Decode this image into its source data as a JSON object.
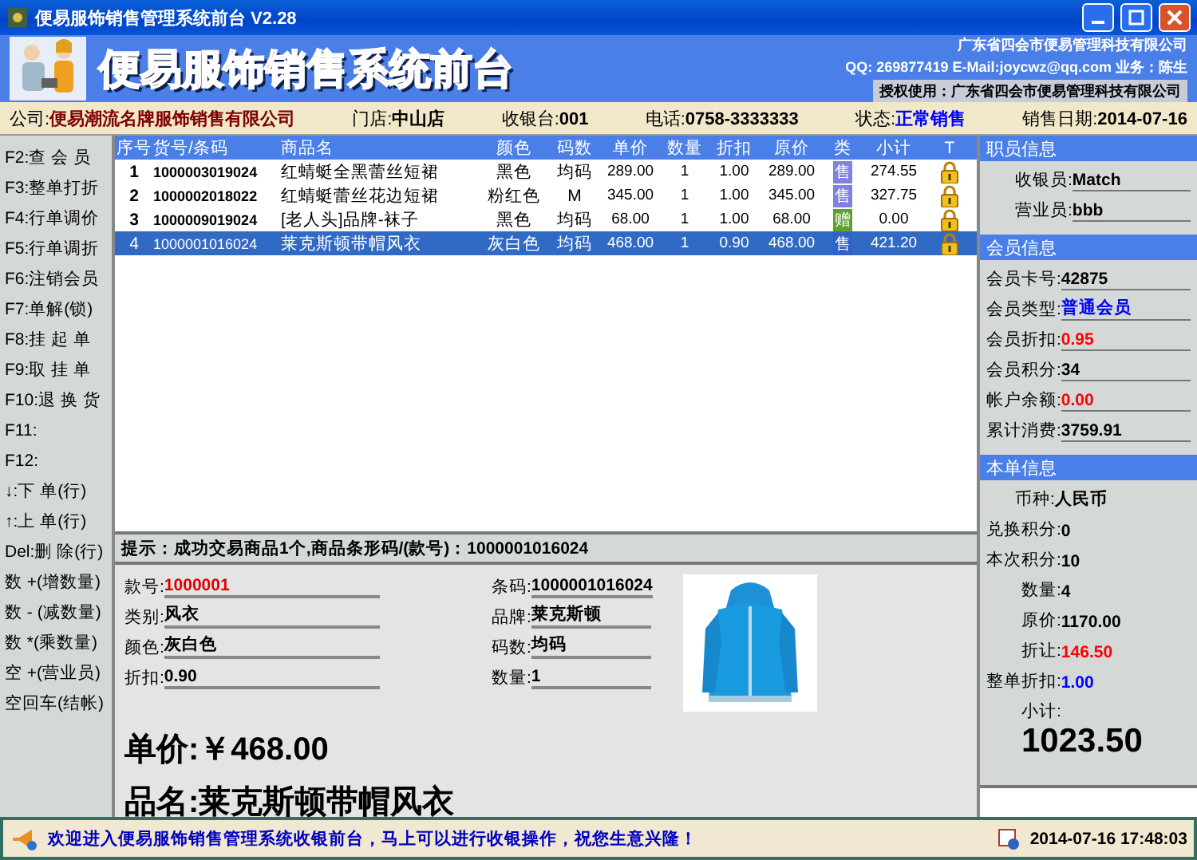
{
  "window": {
    "title": "便易服饰销售管理系统前台 V2.28"
  },
  "banner": {
    "title": "便易服饰销售系统前台",
    "company": "广东省四会市便易管理科技有限公司",
    "contact": "QQ: 269877419 E-Mail:joycwz@qq.com 业务：陈生",
    "license": "授权使用：广东省四会市便易管理科技有限公司"
  },
  "info_bar": [
    {
      "label": "公司:",
      "value": "便易潮流名牌服饰销售有限公司",
      "color": "#800000"
    },
    {
      "label": "门店:",
      "value": "中山店",
      "color": "#000000"
    },
    {
      "label": "收银台:",
      "value": "001",
      "color": "#000000"
    },
    {
      "label": "电话:",
      "value": "0758-3333333",
      "color": "#000000"
    },
    {
      "label": "状态:",
      "value": "正常销售",
      "color": "#0000ff"
    },
    {
      "label": "销售日期:",
      "value": "2014-07-16",
      "color": "#000000"
    }
  ],
  "shortcuts": [
    "F2:查 会 员",
    "F3:整单打折",
    "F4:行单调价",
    "F5:行单调折",
    "F6:注销会员",
    "F7:单解(锁)",
    "F8:挂 起 单",
    "F9:取 挂 单",
    "F10:退 换 货",
    "F11:",
    "F12:",
    "↓:下 单(行)",
    "↑:上 单(行)",
    "Del:删 除(行)",
    "数 +(增数量)",
    "数 - (减数量)",
    "数 *(乘数量)",
    "空 +(营业员)",
    "空回车(结帐)"
  ],
  "table": {
    "columns": [
      "序号",
      "货号/条码",
      "商品名",
      "颜色",
      "码数",
      "单价",
      "数量",
      "折扣",
      "原价",
      "类",
      "小计",
      "T"
    ],
    "rows": [
      {
        "no": "1",
        "code": "1000003019024",
        "name": "红蜻蜓全黑蕾丝短裙",
        "color_name": "黑色",
        "size": "均码",
        "price": "289.00",
        "qty": "1",
        "discount": "1.00",
        "orig": "289.00",
        "category": "售",
        "color": "#8080e0",
        "subtotal": "274.55",
        "selected": false
      },
      {
        "no": "2",
        "code": "1000002018022",
        "name": "红蜻蜓蕾丝花边短裙",
        "color_name": "粉红色",
        "size": "M",
        "price": "345.00",
        "qty": "1",
        "discount": "1.00",
        "orig": "345.00",
        "category": "售",
        "color": "#8080e0",
        "subtotal": "327.75",
        "selected": false
      },
      {
        "no": "3",
        "code": "1000009019024",
        "name": "[老人头]品牌-袜子",
        "color_name": "黑色",
        "size": "均码",
        "price": "68.00",
        "qty": "1",
        "discount": "1.00",
        "orig": "68.00",
        "category": "赠",
        "color": "#60a030",
        "subtotal": "0.00",
        "selected": false
      },
      {
        "no": "4",
        "code": "1000001016024",
        "name": "莱克斯顿带帽风衣",
        "color_name": "灰白色",
        "size": "均码",
        "price": "468.00",
        "qty": "1",
        "discount": "0.90",
        "orig": "468.00",
        "category": "售",
        "color": "#2f63c8",
        "subtotal": "421.20",
        "selected": true
      }
    ]
  },
  "hint": {
    "text": "提示：成功交易商品1个,商品条形码/(款号)：1000001016024"
  },
  "detail": {
    "fields_left": [
      {
        "label": "款号:",
        "value": "1000001",
        "color": "#e00000"
      },
      {
        "label": "类别:",
        "value": "风衣",
        "color": "#000000"
      },
      {
        "label": "颜色:",
        "value": "灰白色",
        "color": "#000000"
      },
      {
        "label": "折扣:",
        "value": "0.90",
        "color": "#000000"
      }
    ],
    "fields_right": [
      {
        "label": "条码:",
        "value": "1000001016024",
        "color": "#000000"
      },
      {
        "label": "品牌:",
        "value": "莱克斯顿",
        "color": "#000000"
      },
      {
        "label": "码数:",
        "value": "均码",
        "color": "#000000"
      },
      {
        "label": "数量:",
        "value": "1",
        "color": "#000000"
      }
    ],
    "price_label": "单价:",
    "price": "￥468.00",
    "name_label": "品名:",
    "name": "莱克斯顿带帽风衣"
  },
  "staff": {
    "title": "职员信息",
    "items": [
      {
        "label": "收银员:",
        "value": "Match"
      },
      {
        "label": "营业员:",
        "value": "bbb"
      }
    ]
  },
  "member": {
    "title": "会员信息",
    "items": [
      {
        "label": "会员卡号:",
        "value": "42875",
        "color": "#000000"
      },
      {
        "label": "会员类型:",
        "value": "普通会员",
        "color": "#0000ff"
      },
      {
        "label": "会员折扣:",
        "value": "0.95",
        "color": "#ff0000"
      },
      {
        "label": "会员积分:",
        "value": "34",
        "color": "#000000"
      },
      {
        "label": "帐户余额:",
        "value": "0.00",
        "color": "#ff0000"
      },
      {
        "label": "累计消费:",
        "value": "3759.91",
        "color": "#000000"
      }
    ]
  },
  "order": {
    "title": "本单信息",
    "items": [
      {
        "label": "币种:",
        "value": "人民币",
        "color": "#000000"
      },
      {
        "label": "兑换积分:",
        "value": "0",
        "color": "#000000"
      },
      {
        "label": "本次积分:",
        "value": "10",
        "color": "#000000"
      },
      {
        "label": "数量:",
        "value": "4",
        "color": "#000000"
      },
      {
        "label": "原价:",
        "value": "1170.00",
        "color": "#000000"
      },
      {
        "label": "折让:",
        "value": "146.50",
        "color": "#ff0000"
      },
      {
        "label": "整单折扣:",
        "value": "1.00",
        "color": "#0000ff"
      }
    ],
    "total_label": "小计:",
    "total": "1023.50"
  },
  "status_bar": {
    "message": "欢迎进入便易服饰销售管理系统收银前台，马上可以进行收银操作，祝您生意兴隆！",
    "datetime": "2014-07-16 17:48:03"
  }
}
